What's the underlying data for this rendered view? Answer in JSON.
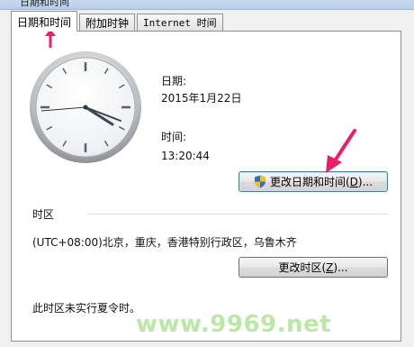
{
  "window": {
    "title": "日期和时间"
  },
  "tabs": [
    {
      "label": "日期和时间"
    },
    {
      "label": "附加时钟"
    },
    {
      "label": "Internet 时间"
    }
  ],
  "datetime": {
    "date_label": "日期:",
    "date_value": "2015年1月22日",
    "time_label": "时间:",
    "time_value": "13:20:44",
    "change_button": {
      "text": "更改日期和时间(",
      "key": "D",
      "suffix": ")..."
    }
  },
  "timezone": {
    "section_label": "时区",
    "value": "(UTC+08:00)北京，重庆，香港特别行政区，乌鲁木齐",
    "change_button": {
      "text": "更改时区(",
      "key": "Z",
      "suffix": ")..."
    },
    "dst_note": "此时区未实行夏令时。"
  },
  "watermark": "www.9969.net",
  "colors": {
    "annotation_arrow": "#e8206a",
    "watermark": "#96dc78"
  }
}
